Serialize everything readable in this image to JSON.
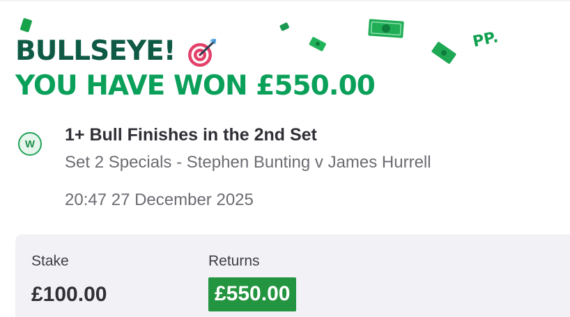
{
  "headline": {
    "line1": "BULLSEYE!",
    "line2": "YOU HAVE WON £550.00"
  },
  "bet": {
    "result_badge": "W",
    "selection": "1+ Bull Finishes in the 2nd Set",
    "market_event": "Set 2 Specials - Stephen Bunting v James Hurrell",
    "datetime": "20:47 27 December 2025"
  },
  "summary": {
    "stake_label": "Stake",
    "stake_value": "£100.00",
    "returns_label": "Returns",
    "returns_value": "£550.00"
  },
  "brand": {
    "logo_text": "PP."
  },
  "colors": {
    "headline_dark": "#0f5a45",
    "headline_green": "#0aa05a",
    "returns_bg": "#23943f",
    "badge_green": "#20a35a",
    "summary_bg": "#f2f2f6"
  },
  "icons": {
    "target": "bullseye-target-icon",
    "money": "banknote-confetti-icon"
  }
}
